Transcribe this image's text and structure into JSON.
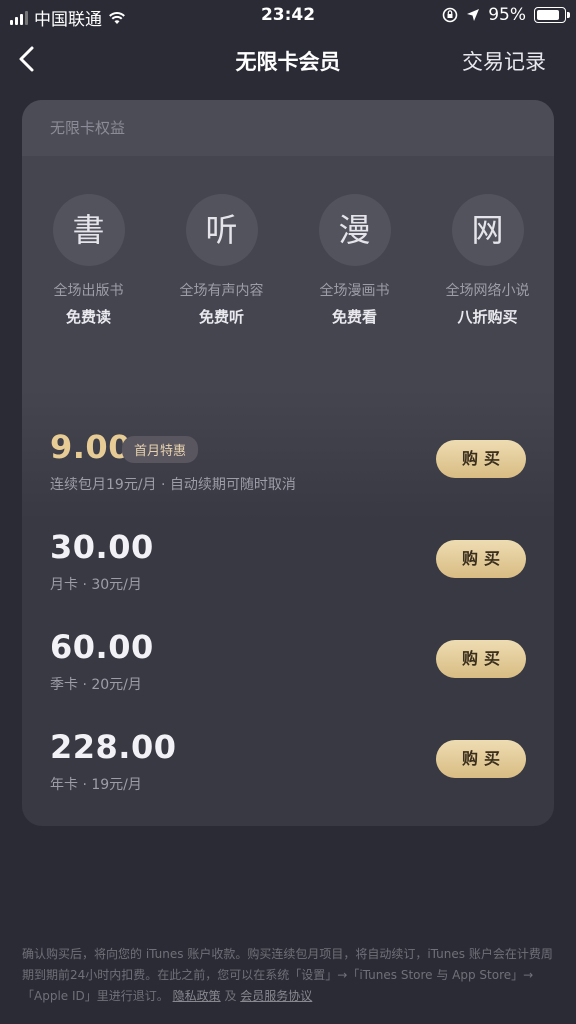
{
  "status_bar": {
    "carrier": "中国联通",
    "time": "23:42",
    "battery": "95%",
    "battery_level": 0.95
  },
  "nav": {
    "title": "无限卡会员",
    "records": "交易记录"
  },
  "card": {
    "header": "无限卡权益",
    "benefits": [
      {
        "icon_char": "書",
        "desc": "全场出版书",
        "sub": "免费读"
      },
      {
        "icon_char": "听",
        "desc": "全场有声内容",
        "sub": "免费听"
      },
      {
        "icon_char": "漫",
        "desc": "全场漫画书",
        "sub": "免费看"
      },
      {
        "icon_char": "网",
        "desc": "全场网络小说",
        "sub": "八折购买"
      }
    ],
    "plans": [
      {
        "price": "9.00",
        "badge": "首月特惠",
        "detail": "连续包月19元/月 · 自动续期可随时取消",
        "button": "购买"
      },
      {
        "price": "30.00",
        "detail": "月卡 · 30元/月",
        "button": "购买"
      },
      {
        "price": "60.00",
        "detail": "季卡 · 20元/月",
        "button": "购买"
      },
      {
        "price": "228.00",
        "detail": "年卡 · 19元/月",
        "button": "购买"
      }
    ]
  },
  "footer": {
    "text": "确认购买后，将向您的 iTunes 账户收款。购买连续包月项目，将自动续订，iTunes 账户会在计费周期到期前24小时内扣费。在此之前，您可以在系统「设置」→「iTunes Store 与 App Store」→「Apple ID」里进行退订。",
    "privacy_link": "隐私政策",
    "conjunction": "及",
    "agreement_link": "会员服务协议"
  },
  "colors": {
    "background": "#2b2b36",
    "gold": "#e8cc95",
    "button": "#e4cc98"
  }
}
